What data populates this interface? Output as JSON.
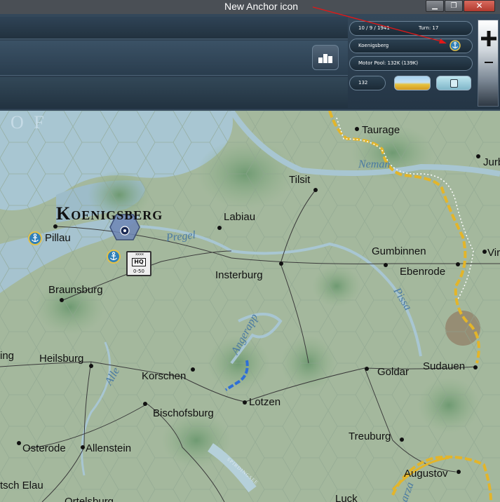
{
  "window": {
    "title": "New Anchor icon",
    "buttons": {
      "minimize": "▁",
      "maximize": "❐",
      "close": "✕"
    }
  },
  "hud": {
    "date": "10 / 9 / 1941",
    "turn": "Turn: 17",
    "location": "Koenigsberg",
    "motor_pool": "Motor Pool: 132K (139K)",
    "count": "132",
    "location_icon": "anchor-icon",
    "weather_icon": "clear-weather-icon",
    "mode_icon": "mode-icon",
    "stats_icon": "bar-chart-icon",
    "zoom_icon": "zoom-plus-icon"
  },
  "map": {
    "sea_text": "O F",
    "big_city": "Koenigsberg",
    "cities": [
      "Taurage",
      "Tilsit",
      "Jurb",
      "Labiau",
      "Pillau",
      "Gumbinnen",
      "Ebenrode",
      "Vir",
      "Insterburg",
      "Braunsburg",
      "ing",
      "Heilsburg",
      "Korschen",
      "Goldar",
      "Sudauen",
      "Lotzen",
      "Bischofsburg",
      "Osterode",
      "Allenstein",
      "Treuburg",
      "tsch Elau",
      "Augustov",
      "Ortelsburg",
      "Luck"
    ],
    "rivers": [
      "Neman",
      "Pregel",
      "Pissa",
      "Angerapp",
      "Alle",
      "arza"
    ],
    "lake": "SPIRDINGSEE",
    "unit": {
      "type": "HQ",
      "strength": "0-50",
      "size": "xxxx"
    }
  },
  "colors": {
    "land": "#9fb59a",
    "water": "#a8c6d2",
    "border_front": "#e3b52a",
    "supply_line": "#2f6fd6"
  }
}
